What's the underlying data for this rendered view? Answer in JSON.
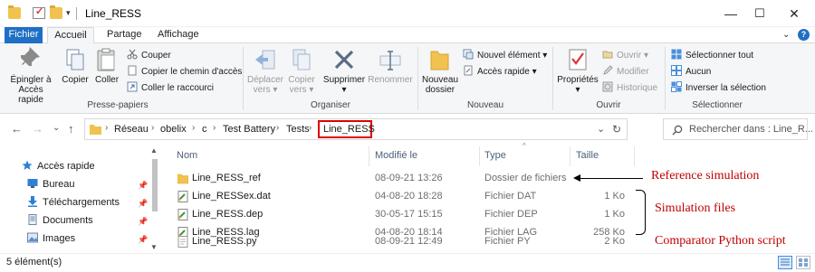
{
  "window": {
    "title": "Line_RESS",
    "controls": {
      "minimize": "—",
      "maximize": "☐",
      "close": "✕"
    }
  },
  "ribbon": {
    "tabs": [
      "Fichier",
      "Accueil",
      "Partage",
      "Affichage"
    ],
    "right": {
      "collapse": "⌄",
      "help": "?"
    },
    "groups": {
      "clipboard": {
        "label": "Presse-papiers",
        "pin": "Épingler à\nAccès rapide",
        "pin_l1": "Épingler à",
        "pin_l2": "Accès rapide",
        "copy": "Copier",
        "paste": "Coller",
        "cut": "Couper",
        "copy_path": "Copier le chemin d'accès",
        "paste_shortcut": "Coller le raccourci"
      },
      "organize": {
        "label": "Organiser",
        "move_l1": "Déplacer",
        "move_l2": "vers",
        "copy_l1": "Copier",
        "copy_l2": "vers",
        "delete": "Supprimer",
        "rename": "Renommer"
      },
      "new": {
        "label": "Nouveau",
        "new_folder_l1": "Nouveau",
        "new_folder_l2": "dossier",
        "new_item": "Nouvel élément",
        "easy_access": "Accès rapide"
      },
      "open": {
        "label": "Ouvrir",
        "properties": "Propriétés",
        "open": "Ouvrir",
        "edit": "Modifier",
        "history": "Historique"
      },
      "select": {
        "label": "Sélectionner",
        "select_all": "Sélectionner tout",
        "select_none": "Aucun",
        "invert": "Inverser la sélection"
      }
    }
  },
  "navigation": {
    "back": "←",
    "forward": "→",
    "recent": "⌄",
    "up": "↑",
    "breadcrumb": [
      "Réseau",
      "obelix",
      "c",
      "Test Battery",
      "Tests",
      "Line_RESS"
    ],
    "separator": "›",
    "refresh": "↻",
    "dropdown": "⌄",
    "search_placeholder": "Rechercher dans : Line_R..."
  },
  "nav_pane": {
    "items": [
      {
        "label": "Accès rapide",
        "icon": "star-icon"
      },
      {
        "label": "Bureau",
        "icon": "desktop-icon"
      },
      {
        "label": "Téléchargements",
        "icon": "download-icon"
      },
      {
        "label": "Documents",
        "icon": "documents-icon"
      },
      {
        "label": "Images",
        "icon": "images-icon"
      }
    ]
  },
  "file_list": {
    "columns": [
      "Nom",
      "Modifié le",
      "Type",
      "Taille"
    ],
    "sort_arrow": "^",
    "rows": [
      {
        "name": "Line_RESS_ref",
        "modified": "08-09-21 13:26",
        "type": "Dossier de fichiers",
        "size": "",
        "icon": "folder-icon"
      },
      {
        "name": "Line_RESSex.dat",
        "modified": "04-08-20 18:28",
        "type": "Fichier DAT",
        "size": "1 Ko",
        "icon": "data-file-icon"
      },
      {
        "name": "Line_RESS.dep",
        "modified": "30-05-17 15:15",
        "type": "Fichier DEP",
        "size": "1 Ko",
        "icon": "data-file-icon"
      },
      {
        "name": "Line_RESS.lag",
        "modified": "04-08-20 18:14",
        "type": "Fichier LAG",
        "size": "258 Ko",
        "icon": "data-file-icon"
      },
      {
        "name": "Line_RESS.py",
        "modified": "08-09-21 12:49",
        "type": "Fichier PY",
        "size": "2 Ko",
        "icon": "python-file-icon"
      }
    ]
  },
  "annotations": {
    "reference": "Reference simulation",
    "simulation": "Simulation files",
    "comparator": "Comparator Python script",
    "color": "#c00000"
  },
  "status": {
    "count": "5 élément(s)"
  },
  "colors": {
    "accent": "#1f6fc5",
    "highlight_box": "#e00000",
    "folder": "#f1c24f"
  }
}
